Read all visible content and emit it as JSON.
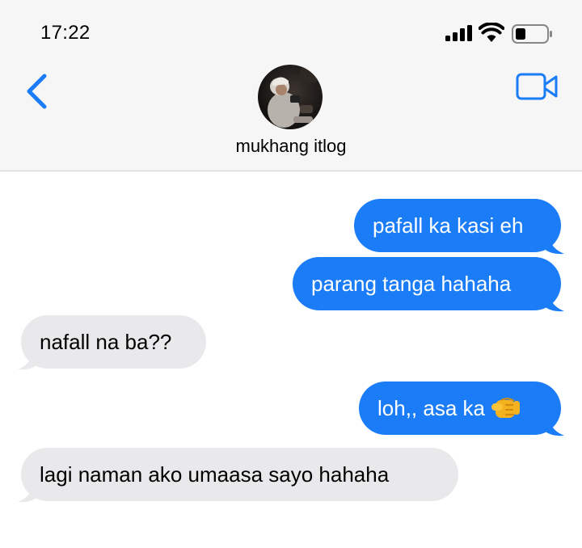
{
  "status_bar": {
    "time": "17:22"
  },
  "contact": {
    "name": "mukhang itlog",
    "avatar_icon": "person-photo"
  },
  "icons": {
    "back": "chevron-left-icon",
    "video": "video-camera-icon"
  },
  "colors": {
    "accent": "#1a7cf7",
    "sent_bubble": "#1a7cf7",
    "received_bubble": "#e9e9eb",
    "header_bg": "#f6f6f7"
  },
  "messages": [
    {
      "direction": "sent",
      "text": "pafall ka kasi eh"
    },
    {
      "direction": "sent",
      "text": "parang tanga hahaha"
    },
    {
      "direction": "received",
      "text": "nafall na ba??"
    },
    {
      "direction": "sent",
      "text": "loh,, asa ka",
      "emoji": "pointing-fist-emoji"
    },
    {
      "direction": "received",
      "text": "lagi naman ako umaasa sayo hahaha"
    }
  ]
}
